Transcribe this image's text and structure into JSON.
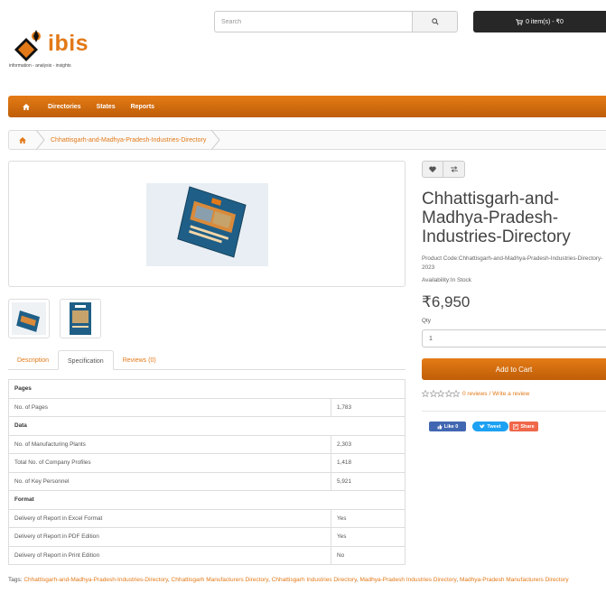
{
  "header": {
    "logo_text": "ibis",
    "logo_tagline": "information - analysis - insights",
    "search_placeholder": "Search",
    "cart_label": "0 item(s) - ₹0"
  },
  "nav": {
    "items": [
      "Directories",
      "States",
      "Reports"
    ]
  },
  "breadcrumb": {
    "current": "Chhattisgarh-and-Madhya-Pradesh-Industries-Directory"
  },
  "tabs": [
    {
      "label": "Description",
      "active": false
    },
    {
      "label": "Specification",
      "active": true
    },
    {
      "label": "Reviews (0)",
      "active": false
    }
  ],
  "specification": {
    "groups": [
      {
        "name": "Pages",
        "rows": [
          {
            "label": "No. of Pages",
            "value": "1,783"
          }
        ]
      },
      {
        "name": "Data",
        "rows": [
          {
            "label": "No. of Manufacturing Plants",
            "value": "2,303"
          },
          {
            "label": "Total No. of Company Profiles",
            "value": "1,418"
          },
          {
            "label": "No. of Key Personnel",
            "value": "5,921"
          }
        ]
      },
      {
        "name": "Format",
        "rows": [
          {
            "label": "Delivery of Report in Excel Format",
            "value": "Yes"
          },
          {
            "label": "Delivery of Report in PDF Edition",
            "value": "Yes"
          },
          {
            "label": "Delivery of Report in Print Edition",
            "value": "No"
          }
        ]
      }
    ]
  },
  "tags": {
    "prefix": "Tags:",
    "items": [
      "Chhattisgarh-and-Madhya-Pradesh-Industries-Directory",
      "Chhattisgarh Manufacturers Directory",
      "Chhattisgarh Industries Directory",
      "Madhya-Pradesh Industries Directory",
      "Madhya-Pradesh Manufacturers Directory"
    ]
  },
  "product": {
    "title": "Chhattisgarh-and-Madhya-Pradesh-Industries-Directory",
    "product_code_label": "Product Code:",
    "product_code": "Chhattisgarh-and-Madhya-Pradesh-Industries-Directory-2023",
    "availability_label": "Availability:",
    "availability": "In Stock",
    "price": "₹6,950",
    "qty_label": "Qty",
    "qty_value": "1",
    "add_to_cart": "Add to Cart",
    "reviews_link": "0 reviews",
    "write_review_link": "Write a review",
    "rating_value": 0,
    "rating_max": 5
  },
  "social": {
    "like": "Like 0",
    "tweet": "Tweet",
    "share": "Share"
  },
  "colors": {
    "accent": "#e27918",
    "nav_top": "#e47b16",
    "nav_bottom": "#bf5e07",
    "cart_bg": "#272727"
  }
}
